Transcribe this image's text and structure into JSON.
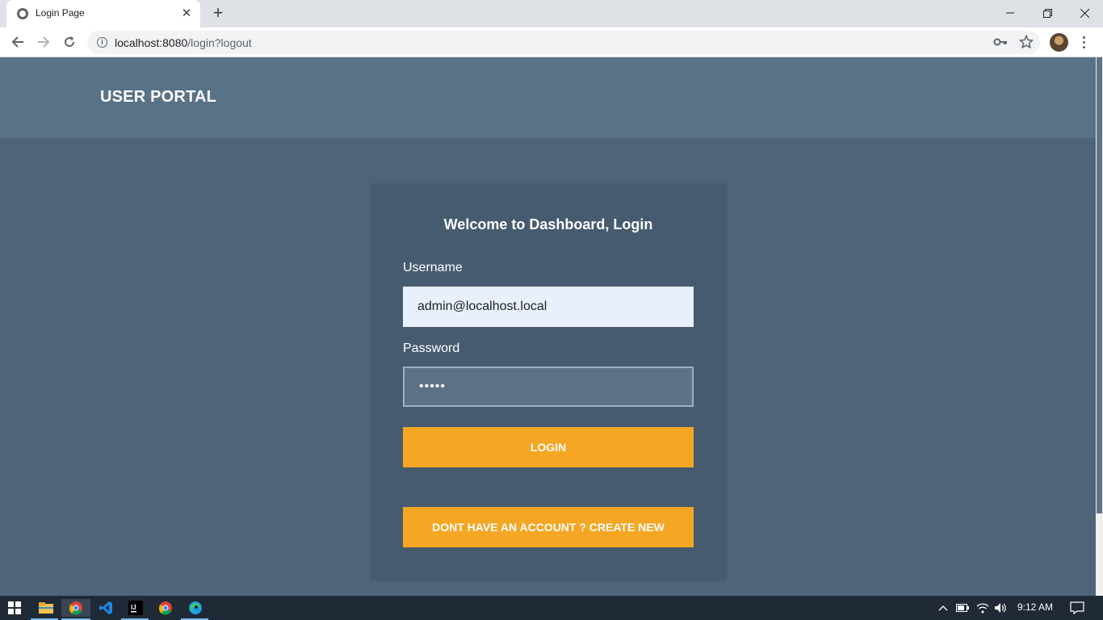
{
  "browser": {
    "tab_title": "Login Page",
    "url_host": "localhost:8080",
    "url_path": "/login?logout"
  },
  "header": {
    "brand": "USER PORTAL"
  },
  "login": {
    "title": "Welcome to Dashboard, Login",
    "username_label": "Username",
    "username_value": "admin@localhost.local",
    "password_label": "Password",
    "password_mask": "•••••",
    "login_button": "LOGIN",
    "create_button": "DONT HAVE AN ACCOUNT ? CREATE NEW"
  },
  "taskbar": {
    "time": "9:12 AM",
    "icons": [
      "windows-start-icon",
      "file-explorer-icon",
      "chrome-icon",
      "vscode-icon",
      "intellij-icon",
      "chrome-icon",
      "edge-icon"
    ]
  },
  "colors": {
    "header_bg": "#587287",
    "page_bg": "#4f6478",
    "card_bg": "#465b6f",
    "button": "#f5a623"
  }
}
